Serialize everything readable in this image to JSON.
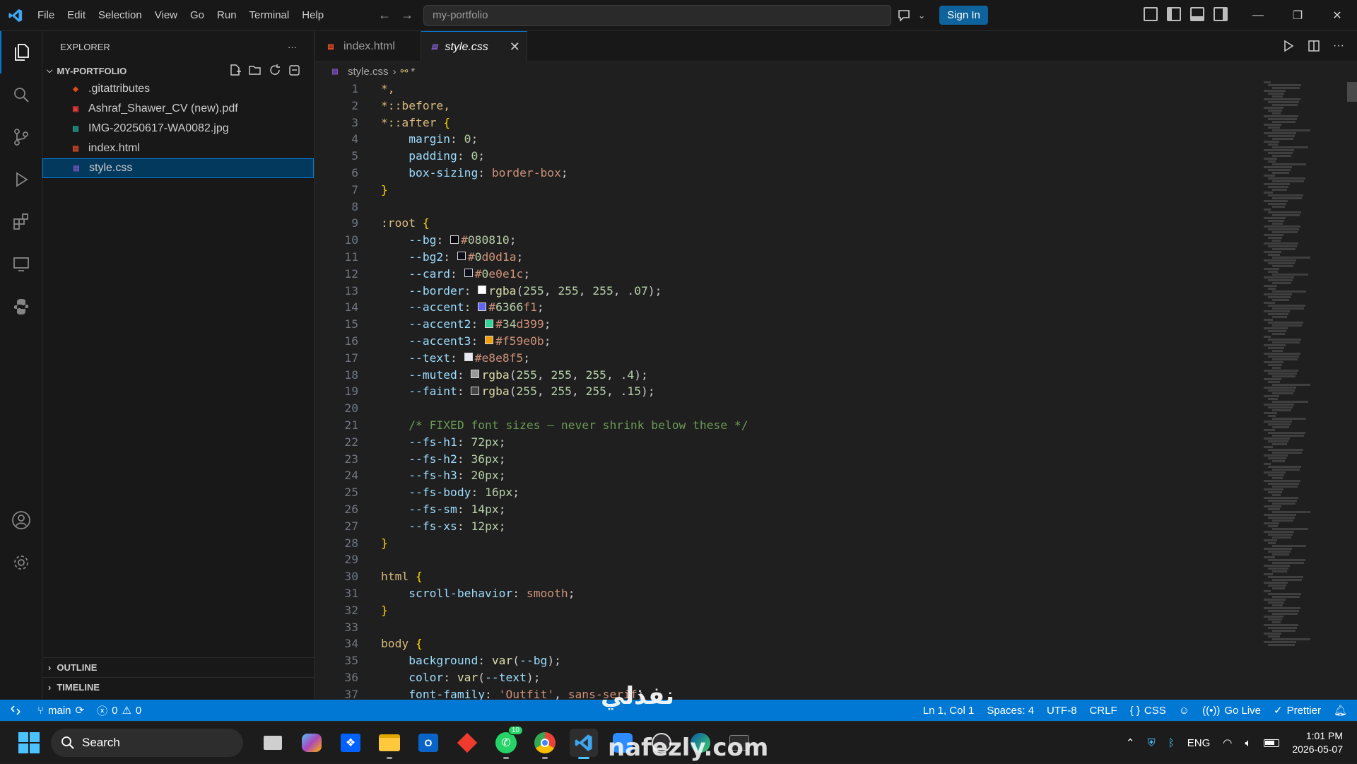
{
  "titlebar": {
    "menu": [
      "File",
      "Edit",
      "Selection",
      "View",
      "Go",
      "Run",
      "Terminal",
      "Help"
    ],
    "search_text": "my-portfolio",
    "sign_in": "Sign In"
  },
  "sidebar": {
    "title": "EXPLORER",
    "folder": "MY-PORTFOLIO",
    "files": [
      {
        "name": ".gitattributes",
        "icon": "git-icon",
        "color": "#e64a19"
      },
      {
        "name": "Ashraf_Shawer_CV (new).pdf",
        "icon": "pdf-icon",
        "color": "#e53935"
      },
      {
        "name": "IMG-20250617-WA0082.jpg",
        "icon": "image-icon",
        "color": "#26a69a"
      },
      {
        "name": "index.html",
        "icon": "html-icon",
        "color": "#e44d26"
      },
      {
        "name": "style.css",
        "icon": "css-icon",
        "color": "#7e57c2"
      }
    ],
    "selected_file": "style.css",
    "outline": "OUTLINE",
    "timeline": "TIMELINE"
  },
  "tabs": [
    {
      "label": "index.html",
      "active": false
    },
    {
      "label": "style.css",
      "active": true
    }
  ],
  "breadcrumb": {
    "file": "style.css",
    "symbol": "*"
  },
  "code_lines": [
    "*,",
    "*::before,",
    "*::after {",
    "    margin: 0;",
    "    padding: 0;",
    "    box-sizing: border-box;",
    "}",
    "",
    ":root {",
    "    --bg: #080810;",
    "    --bg2: #0d0d1a;",
    "    --card: #0e0e1c;",
    "    --border: rgba(255, 255, 255, .07);",
    "    --accent: #6366f1;",
    "    --accent2: #34d399;",
    "    --accent3: #f59e0b;",
    "    --text: #e8e8f5;",
    "    --muted: rgba(255, 255, 255, .4);",
    "    --faint: rgba(255, 255, 255, .15);",
    "",
    "    /* FIXED font sizes — never shrink below these */",
    "    --fs-h1: 72px;",
    "    --fs-h2: 36px;",
    "    --fs-h3: 20px;",
    "    --fs-body: 16px;",
    "    --fs-sm: 14px;",
    "    --fs-xs: 12px;",
    "}",
    "",
    "html {",
    "    scroll-behavior: smooth;",
    "}",
    "",
    "body {",
    "    background: var(--bg);",
    "    color: var(--text);",
    "    font-family: 'Outfit', sans-serif;"
  ],
  "swatches": {
    "10": "#080810",
    "11": "#0d0d1a",
    "12": "#0e0e1c",
    "13": "#ffffff",
    "14": "#6366f1",
    "15": "#34d399",
    "16": "#f59e0b",
    "17": "#e8e8f5",
    "18": "#999999",
    "19": "#444444"
  },
  "status": {
    "branch": "main",
    "errors": "0",
    "warnings": "0",
    "position": "Ln 1, Col 1",
    "spaces": "Spaces: 4",
    "encoding": "UTF-8",
    "eol": "CRLF",
    "language": "CSS",
    "go_live": "Go Live",
    "prettier": "Prettier"
  },
  "taskbar": {
    "search": "Search",
    "lang": "ENG",
    "time": "1:01 PM",
    "date": "2026-05-07",
    "whatsapp_badge": "10"
  },
  "watermark": {
    "arabic": "نفذلي",
    "latin": "nafezly.com"
  }
}
